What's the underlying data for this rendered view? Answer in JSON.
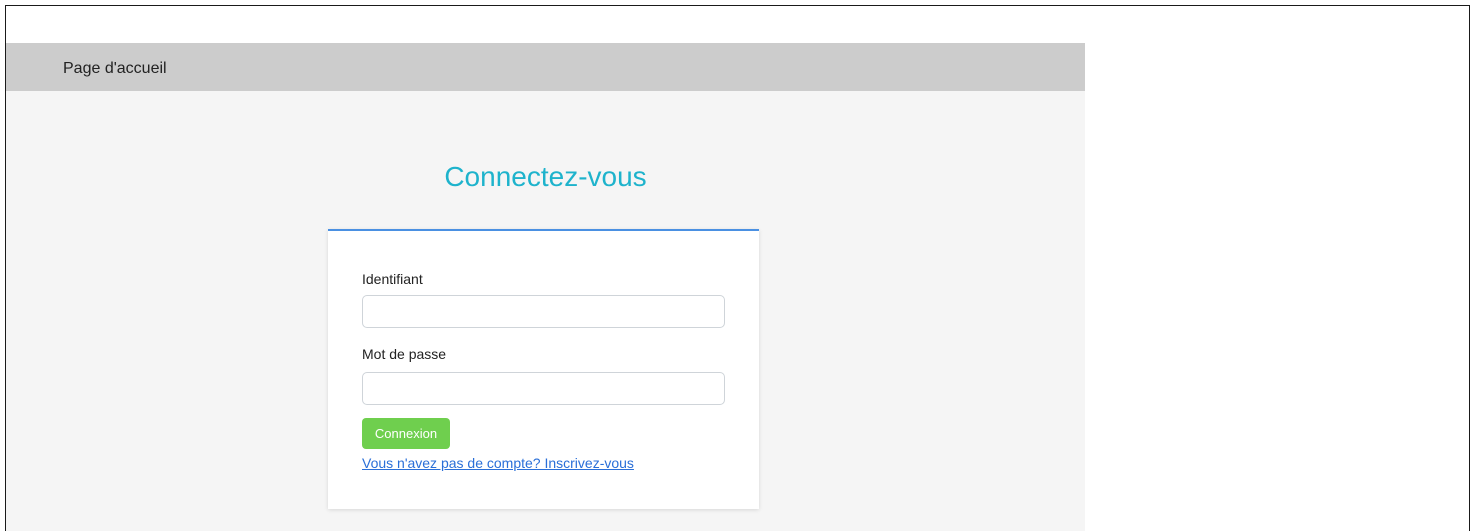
{
  "nav": {
    "home_label": "Page d'accueil"
  },
  "login": {
    "title": "Connectez-vous",
    "username_label": "Identifiant",
    "username_value": "",
    "password_label": "Mot de passe",
    "password_value": "",
    "submit_label": "Connexion",
    "signup_link": "Vous n'avez pas de compte? Inscrivez-vous"
  },
  "colors": {
    "title": "#1eb3cc",
    "button": "#6fcf4e",
    "card_top_border": "#4a90e2",
    "link": "#2a6fd8",
    "topbar": "#cccccc",
    "page_bg": "#f5f5f5"
  }
}
